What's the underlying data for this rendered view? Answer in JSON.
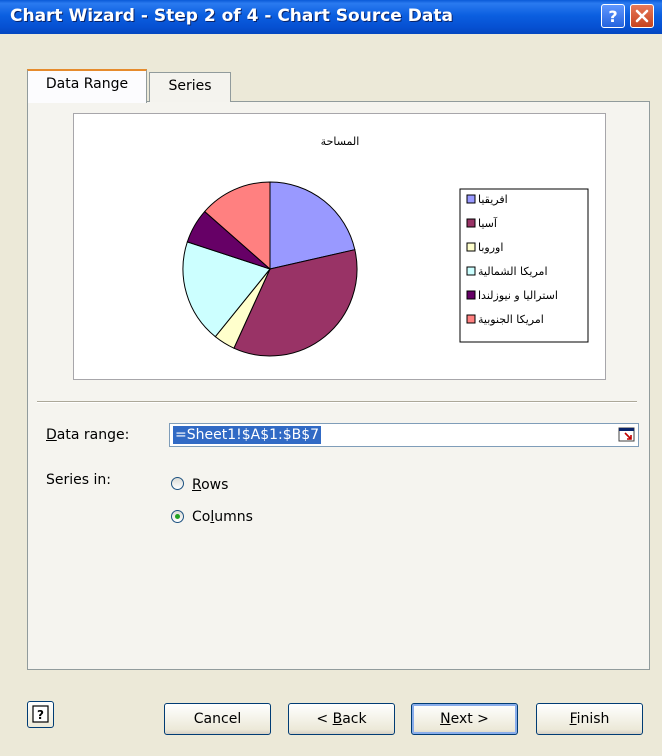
{
  "window": {
    "title": "Chart Wizard - Step 2 of 4 - Chart Source Data"
  },
  "tabs": [
    {
      "label": "Data Range",
      "active": true
    },
    {
      "label": "Series",
      "active": false
    }
  ],
  "chart_data": {
    "type": "pie",
    "title": "المساحة",
    "categories": [
      "افريقيا",
      "آسيا",
      "اوروبا",
      "امريكا الشمالية",
      "استراليا و نيوزلندا",
      "امريكا الجنوبية"
    ],
    "values": [
      20.3,
      33.5,
      3.8,
      18.2,
      6.1,
      12.8
    ],
    "colors": [
      "#9999ff",
      "#993366",
      "#ffffcc",
      "#ccffff",
      "#660066",
      "#ff8080"
    ],
    "legend": "right"
  },
  "form": {
    "data_range_label": "Data range:",
    "data_range_value": "=Sheet1!$A$1:$B$7",
    "series_in_label": "Series in:",
    "rows_label": "Rows",
    "columns_label": "Columns",
    "series_in_selected": "Columns"
  },
  "buttons": {
    "cancel": "Cancel",
    "back": "< Back",
    "next": "Next >",
    "finish": "Finish"
  }
}
